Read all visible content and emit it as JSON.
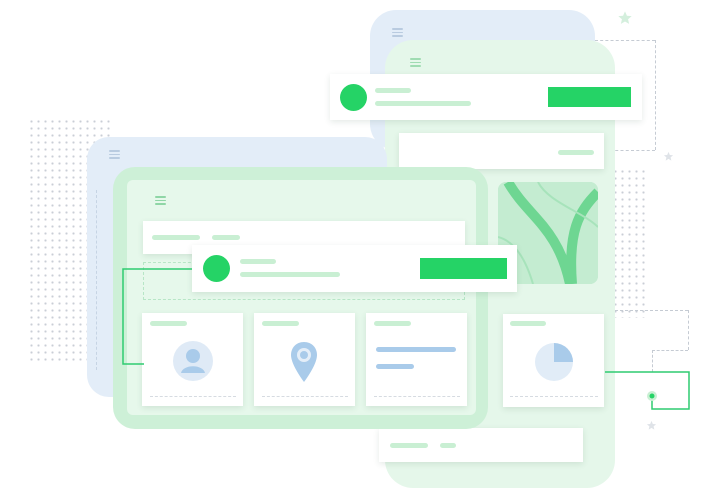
{
  "illustration": {
    "colors": {
      "accent": "#25d366",
      "accent_light": "#c9efd3",
      "panel_green": "#e4f6e9",
      "panel_blue": "#e3edf8",
      "icon_blue": "#a9cbea",
      "connector": "#2ecc71",
      "star": "#d7efe0"
    },
    "icons": [
      "menu-icon",
      "user-icon",
      "location-pin-icon",
      "pie-chart-icon",
      "map-icon",
      "star-icon"
    ]
  }
}
